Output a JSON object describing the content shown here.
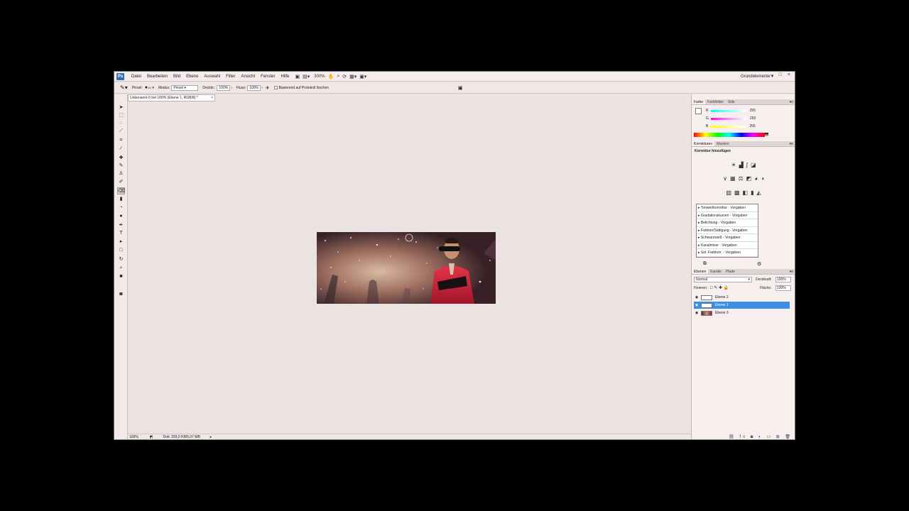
{
  "menubar": {
    "logo": "Ps",
    "items": [
      "Datei",
      "Bearbeiten",
      "Bild",
      "Ebene",
      "Auswahl",
      "Filter",
      "Ansicht",
      "Fenster",
      "Hilfe"
    ],
    "zoom": "300%",
    "workspace": "Grundelemente",
    "window_controls": "– □ ×"
  },
  "options": {
    "pinsel_label": "Pinsel:",
    "pinsel_size": "13",
    "modus_label": "Modus:",
    "modus_value": "Pinsel",
    "deckkr_label": "Deckkr.:",
    "deckkr_value": "100%",
    "fluss_label": "Fluss:",
    "fluss_value": "100%",
    "protokoll_label": "Basierend auf Protokoll löschen"
  },
  "document": {
    "tab_title": "Unbenannt-5 bei 100% (Ebene 1, RGB/8) *",
    "close": "×",
    "status_zoom": "100%",
    "status_doc": "Dok: 293,0 KB/5,07 MB"
  },
  "color_panel": {
    "tabs": [
      "Farbe",
      "Farbfelder",
      "Stile"
    ],
    "channels": [
      {
        "label": "R",
        "value": "255",
        "color": "#ff3b3b"
      },
      {
        "label": "G",
        "value": "255",
        "color": "#3bd43b"
      },
      {
        "label": "B",
        "value": "255",
        "color": "#3b6bff"
      }
    ]
  },
  "adjustments": {
    "tabs": [
      "Korrekturen",
      "Masken"
    ],
    "heading": "Korrektur hinzufügen",
    "presets": [
      "Tonwertkorrektur - Vorgaben",
      "Gradationskurven - Vorgaben",
      "Belichtung - Vorgaben",
      "Farbton/Sättigung - Vorgaben",
      "Schwarzweiß - Vorgaben",
      "Kanalmixer - Vorgaben",
      "Sel. Farbkorr. - Vorgaben"
    ]
  },
  "layers": {
    "tabs": [
      "Ebenen",
      "Kanäle",
      "Pfade"
    ],
    "blend_mode": "Normal",
    "opacity_label": "Deckkraft:",
    "opacity_value": "100%",
    "lock_label": "Fixieren:",
    "fill_label": "Fläche:",
    "fill_value": "100%",
    "items": [
      {
        "name": "Ebene 2",
        "selected": false
      },
      {
        "name": "Ebene 1",
        "selected": true
      },
      {
        "name": "Ebene 3",
        "selected": false
      }
    ]
  }
}
